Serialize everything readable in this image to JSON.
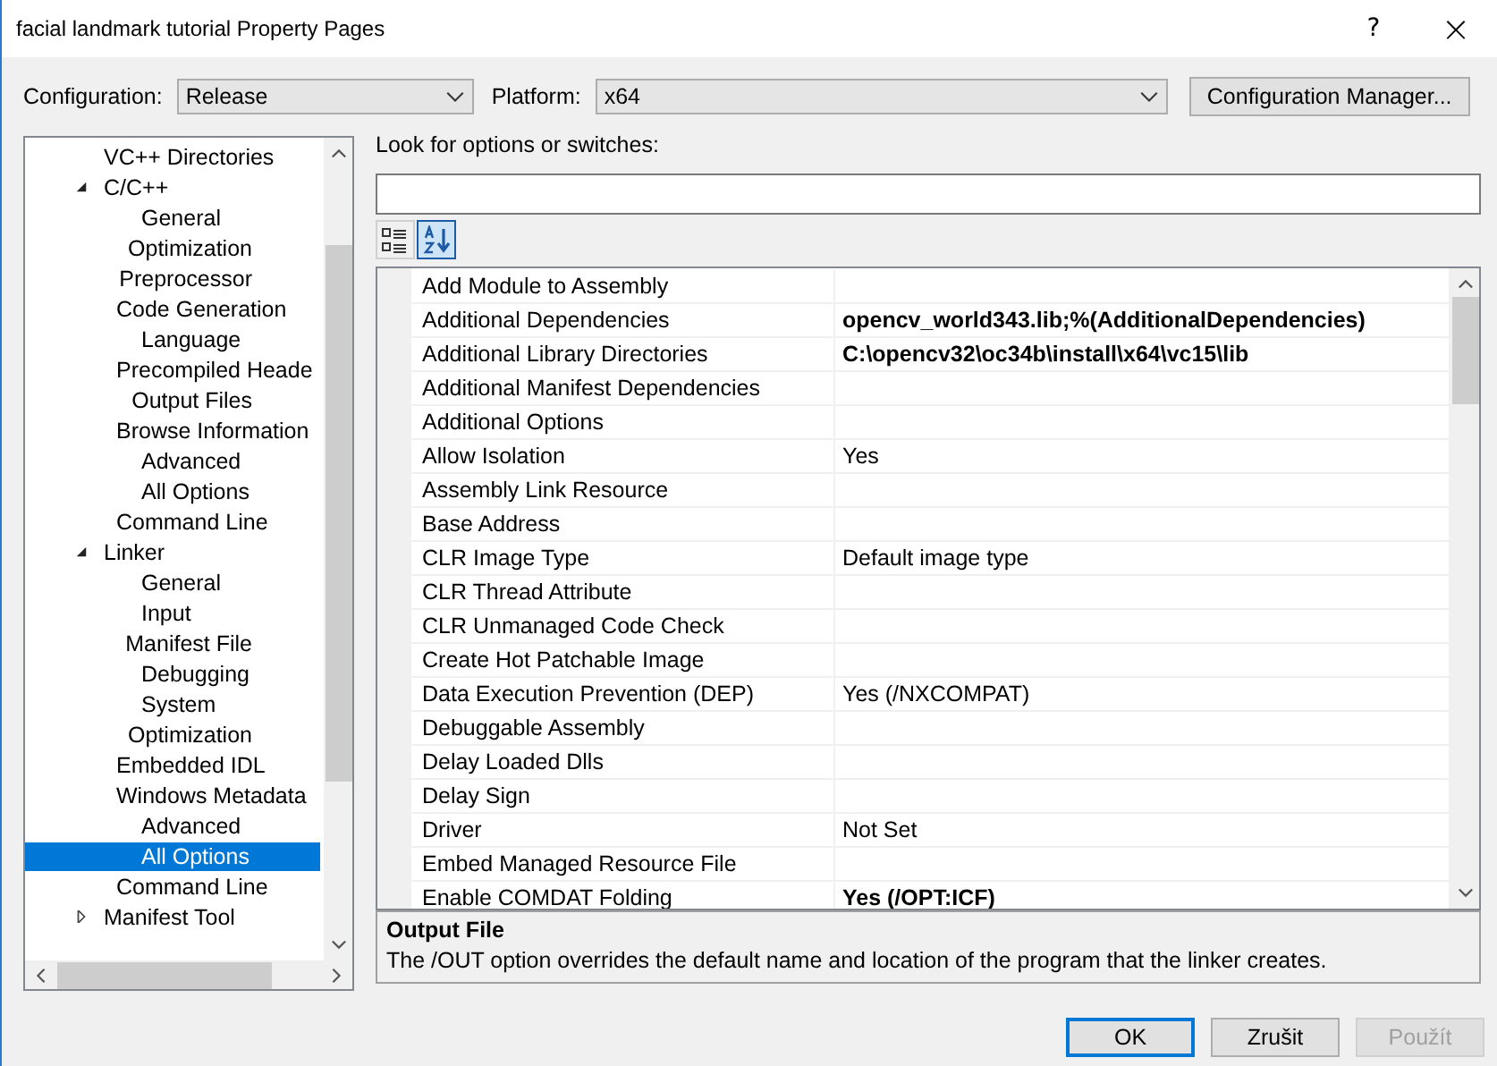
{
  "window": {
    "title": "facial landmark tutorial Property Pages",
    "help": "?",
    "close": "×"
  },
  "configuration": {
    "label": "Configuration:",
    "value": "Release"
  },
  "platform": {
    "label": "Platform:",
    "value": "x64"
  },
  "config_manager_button": "Configuration Manager...",
  "tree": [
    {
      "label": "VC++ Directories",
      "selected": false
    },
    {
      "label": "C/C++",
      "selected": false,
      "expanded": true,
      "children": [
        {
          "label": "General",
          "selected": false
        },
        {
          "label": "Optimization",
          "selected": false
        },
        {
          "label": "Preprocessor",
          "selected": false
        },
        {
          "label": "Code Generation",
          "selected": false
        },
        {
          "label": "Language",
          "selected": false
        },
        {
          "label": "Precompiled Heade",
          "selected": false
        },
        {
          "label": "Output Files",
          "selected": false
        },
        {
          "label": "Browse Information",
          "selected": false
        },
        {
          "label": "Advanced",
          "selected": false
        },
        {
          "label": "All Options",
          "selected": false
        },
        {
          "label": "Command Line",
          "selected": false
        }
      ]
    },
    {
      "label": "Linker",
      "selected": false,
      "expanded": true,
      "children": [
        {
          "label": "General",
          "selected": false
        },
        {
          "label": "Input",
          "selected": false
        },
        {
          "label": "Manifest File",
          "selected": false
        },
        {
          "label": "Debugging",
          "selected": false
        },
        {
          "label": "System",
          "selected": false
        },
        {
          "label": "Optimization",
          "selected": false
        },
        {
          "label": "Embedded IDL",
          "selected": false
        },
        {
          "label": "Windows Metadata",
          "selected": false
        },
        {
          "label": "Advanced",
          "selected": false
        },
        {
          "label": "All Options",
          "selected": true
        },
        {
          "label": "Command Line",
          "selected": false
        }
      ]
    },
    {
      "label": "Manifest Tool",
      "selected": false,
      "expanded": false
    }
  ],
  "search": {
    "label": "Look for options or switches:"
  },
  "view_buttons": [
    {
      "kind": "categorized",
      "selected": false
    },
    {
      "kind": "alphabetical",
      "selected": true
    }
  ],
  "properties": [
    {
      "name": "Add Module to Assembly"
    },
    {
      "name": "Additional Dependencies",
      "value": "opencv_world343.lib;%(AdditionalDependencies)",
      "modified": true
    },
    {
      "name": "Additional Library Directories",
      "value": "C:\\opencv32\\oc34b\\install\\x64\\vc15\\lib",
      "modified": true
    },
    {
      "name": "Additional Manifest Dependencies"
    },
    {
      "name": "Additional Options"
    },
    {
      "name": "Allow Isolation",
      "value": "Yes",
      "modified": false
    },
    {
      "name": "Assembly Link Resource"
    },
    {
      "name": "Base Address"
    },
    {
      "name": "CLR Image Type",
      "value": "Default image type",
      "modified": false
    },
    {
      "name": "CLR Thread Attribute"
    },
    {
      "name": "CLR Unmanaged Code Check"
    },
    {
      "name": "Create Hot Patchable Image"
    },
    {
      "name": "Data Execution Prevention (DEP)",
      "value": "Yes (/NXCOMPAT)",
      "modified": false
    },
    {
      "name": "Debuggable Assembly"
    },
    {
      "name": "Delay Loaded Dlls"
    },
    {
      "name": "Delay Sign"
    },
    {
      "name": "Driver",
      "value": "Not Set",
      "modified": false
    },
    {
      "name": "Embed Managed Resource File"
    },
    {
      "name": "Enable COMDAT Folding",
      "value": "Yes (/OPT:ICF)",
      "modified": true
    }
  ],
  "description": {
    "title": "Output File",
    "text": "The /OUT option overrides the default name and location of the program that the linker creates."
  },
  "buttons": [
    {
      "label": "OK",
      "kind": "default",
      "disabled": false
    },
    {
      "label": "Zrušit",
      "kind": "normal",
      "disabled": false
    },
    {
      "label": "Použít",
      "kind": "normal",
      "disabled": true
    }
  ]
}
